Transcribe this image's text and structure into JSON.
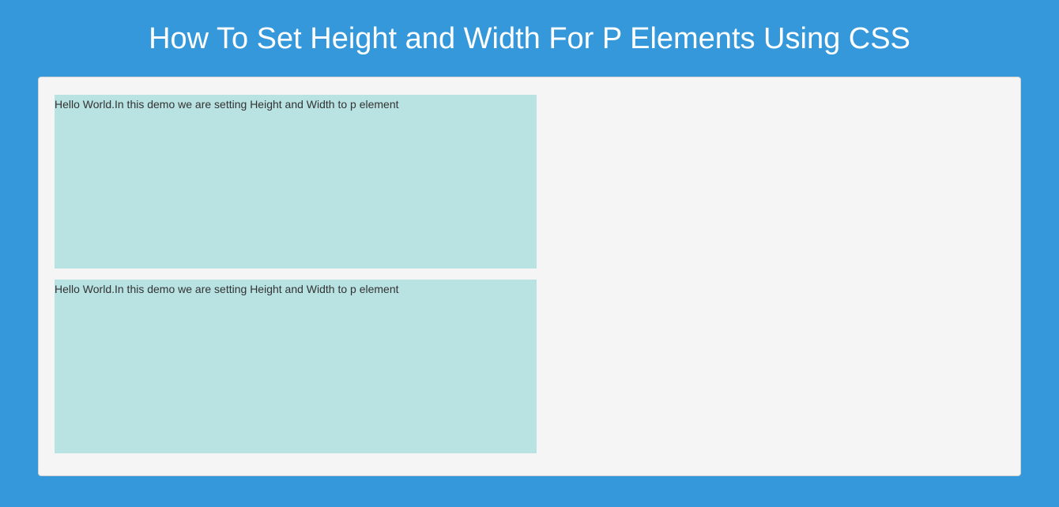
{
  "page": {
    "title": "How To Set Height and Width For P Elements Using CSS"
  },
  "paragraphs": [
    {
      "text": "Hello World.In this demo we are setting Height and Width to p element"
    },
    {
      "text": "Hello World.In this demo we are setting Height and Width to p element"
    }
  ]
}
